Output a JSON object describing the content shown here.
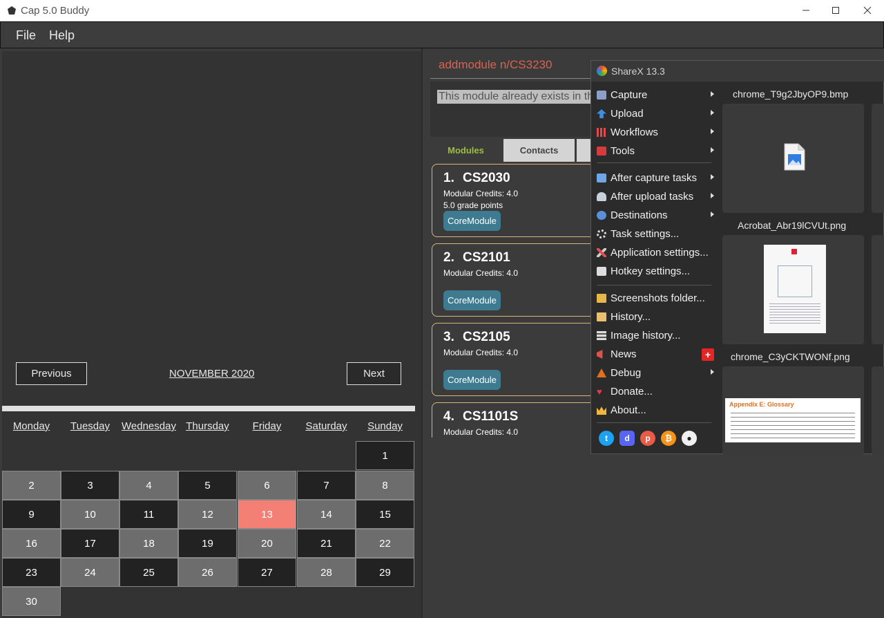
{
  "window": {
    "title": "Cap 5.0 Buddy",
    "controls": [
      "minimize",
      "maximize",
      "close"
    ]
  },
  "menubar": {
    "items": [
      "File",
      "Help"
    ]
  },
  "calendar": {
    "previous_label": "Previous",
    "next_label": "Next",
    "month": "NOVEMBER 2020",
    "days": [
      "Monday",
      "Tuesday",
      "Wednesday",
      "Thursday",
      "Friday",
      "Saturday",
      "Sunday"
    ],
    "dates": [
      "1",
      "2",
      "3",
      "4",
      "5",
      "6",
      "7",
      "8",
      "9",
      "10",
      "11",
      "12",
      "13",
      "14",
      "15",
      "16",
      "17",
      "18",
      "19",
      "20",
      "21",
      "22",
      "23",
      "24",
      "25",
      "26",
      "27",
      "28",
      "29",
      "30"
    ],
    "highlighted_date": "13",
    "colors": {
      "today": "#f47f75",
      "grey": "#6d6d6d",
      "dark": "#222222"
    }
  },
  "command": {
    "input_value": "addmodule n/CS3230",
    "result_text": "This module already exists in th"
  },
  "tabs": [
    "Modules",
    "Contacts"
  ],
  "modules": [
    {
      "index": "1.",
      "code": "CS2030",
      "credits": "Modular Credits: 4.0",
      "points": "5.0 grade points",
      "tag": "CoreModule"
    },
    {
      "index": "2.",
      "code": "CS2101",
      "credits": "Modular Credits: 4.0",
      "points": "",
      "tag": "CoreModule"
    },
    {
      "index": "3.",
      "code": "CS2105",
      "credits": "Modular Credits: 4.0",
      "points": "",
      "tag": "CoreModule"
    },
    {
      "index": "4.",
      "code": "CS1101S",
      "credits": "Modular Credits: 4.0",
      "points": "",
      "tag": ""
    }
  ],
  "sharex": {
    "title": "ShareX 13.3",
    "menu": [
      {
        "label": "Capture",
        "icon": "capture-icon",
        "submenu": true
      },
      {
        "label": "Upload",
        "icon": "upload-icon",
        "submenu": true
      },
      {
        "label": "Workflows",
        "icon": "workflows-icon",
        "submenu": true
      },
      {
        "label": "Tools",
        "icon": "tools-icon",
        "submenu": true
      },
      {
        "label": "After capture tasks",
        "icon": "after-capture-icon",
        "submenu": true
      },
      {
        "label": "After upload tasks",
        "icon": "after-upload-icon",
        "submenu": true
      },
      {
        "label": "Destinations",
        "icon": "destinations-icon",
        "submenu": true
      },
      {
        "label": "Task settings...",
        "icon": "gear-icon",
        "submenu": false
      },
      {
        "label": "Application settings...",
        "icon": "wrench-icon",
        "submenu": false
      },
      {
        "label": "Hotkey settings...",
        "icon": "keyboard-icon",
        "submenu": false
      },
      {
        "label": "Screenshots folder...",
        "icon": "folder-icon",
        "submenu": false
      },
      {
        "label": "History...",
        "icon": "history-icon",
        "submenu": false
      },
      {
        "label": "Image history...",
        "icon": "image-history-icon",
        "submenu": false
      },
      {
        "label": "News",
        "icon": "megaphone-icon",
        "submenu": false,
        "badge": "+"
      },
      {
        "label": "Debug",
        "icon": "bug-icon",
        "submenu": true
      },
      {
        "label": "Donate...",
        "icon": "heart-icon",
        "submenu": false
      },
      {
        "label": "About...",
        "icon": "crown-icon",
        "submenu": false
      }
    ],
    "social": [
      "twitter-icon",
      "discord-icon",
      "patreon-icon",
      "bitcoin-icon",
      "github-icon"
    ],
    "recent": [
      {
        "name": "chrome_T9g2JbyOP9.bmp"
      },
      {
        "name": "Acrobat_Abr19lCVUt.png"
      },
      {
        "name": "chrome_C3yCKTWONf.png",
        "preview_heading": "Appendix E: Glossary"
      }
    ]
  }
}
